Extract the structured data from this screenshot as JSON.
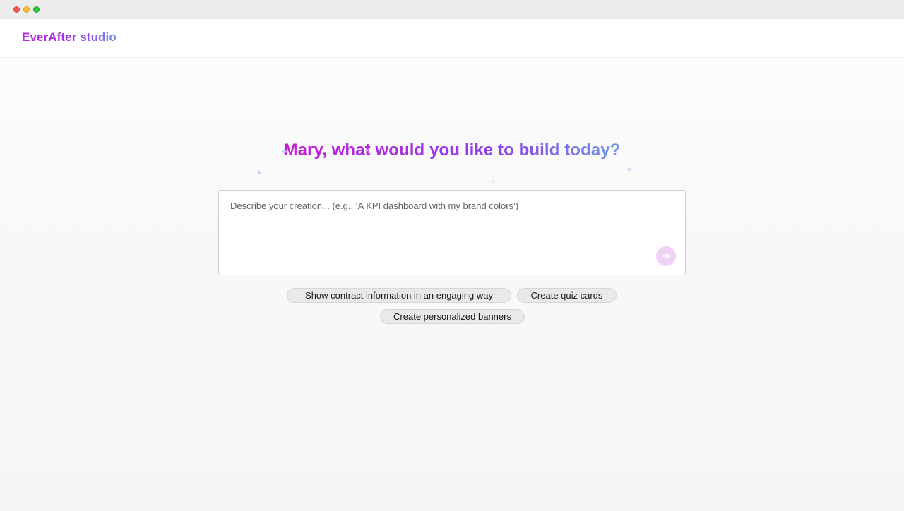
{
  "window": {
    "traffic_lights": [
      "close",
      "minimize",
      "maximize"
    ]
  },
  "header": {
    "brand": "EverAfter studio"
  },
  "hero": {
    "title": "Mary, what would you like to build today?"
  },
  "prompt": {
    "placeholder": "Describe your creation... (e.g., ‘A KPI dashboard with my brand colors’)",
    "value": "",
    "send_icon": "arrow-right-icon"
  },
  "suggestions": [
    {
      "label": "Show contract information in an engaging way"
    },
    {
      "label": "Create quiz cards"
    },
    {
      "label": "Create personalized banners"
    }
  ],
  "colors": {
    "brand_gradient_start": "#c01fe0",
    "brand_gradient_end": "#6d8ff0",
    "send_button_bg": "#f0d2f7"
  }
}
